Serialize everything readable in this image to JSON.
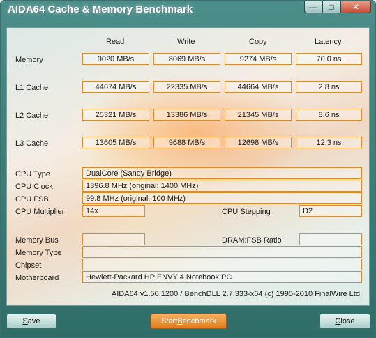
{
  "window": {
    "title": "AIDA64 Cache & Memory Benchmark"
  },
  "controls": {
    "minimize": "—",
    "maximize": "□",
    "close": "✕"
  },
  "columns": [
    "Read",
    "Write",
    "Copy",
    "Latency"
  ],
  "rows": [
    {
      "label": "Memory",
      "read": "9020 MB/s",
      "write": "8069 MB/s",
      "copy": "9274 MB/s",
      "latency": "70.0 ns"
    },
    {
      "label": "L1 Cache",
      "read": "44674 MB/s",
      "write": "22335 MB/s",
      "copy": "44664 MB/s",
      "latency": "2.8 ns"
    },
    {
      "label": "L2 Cache",
      "read": "25321 MB/s",
      "write": "13386 MB/s",
      "copy": "21345 MB/s",
      "latency": "8.6 ns"
    },
    {
      "label": "L3 Cache",
      "read": "13605 MB/s",
      "write": "9688 MB/s",
      "copy": "12698 MB/s",
      "latency": "12.3 ns"
    }
  ],
  "info": {
    "cpu_type_label": "CPU Type",
    "cpu_type": "DualCore   (Sandy Bridge)",
    "cpu_clock_label": "CPU Clock",
    "cpu_clock": "1396.8 MHz  (original: 1400 MHz)",
    "cpu_fsb_label": "CPU FSB",
    "cpu_fsb": "99.8 MHz  (original: 100 MHz)",
    "cpu_multiplier_label": "CPU Multiplier",
    "cpu_multiplier": "14x",
    "cpu_stepping_label": "CPU Stepping",
    "cpu_stepping": "D2",
    "memory_bus_label": "Memory Bus",
    "memory_bus": "",
    "dram_fsb_label": "DRAM:FSB Ratio",
    "dram_fsb": "",
    "memory_type_label": "Memory Type",
    "memory_type": "",
    "chipset_label": "Chipset",
    "chipset": "",
    "motherboard_label": "Motherboard",
    "motherboard": "Hewlett-Packard HP ENVY 4 Notebook PC"
  },
  "footer": "AIDA64 v1.50.1200 / BenchDLL 2.7.333-x64  (c) 1995-2010 FinalWire Ltd.",
  "buttons": {
    "save_underline": "S",
    "save_rest": "ave",
    "start_pre": "Start ",
    "start_underline": "B",
    "start_rest": "enchmark",
    "close_underline": "C",
    "close_rest": "lose"
  }
}
